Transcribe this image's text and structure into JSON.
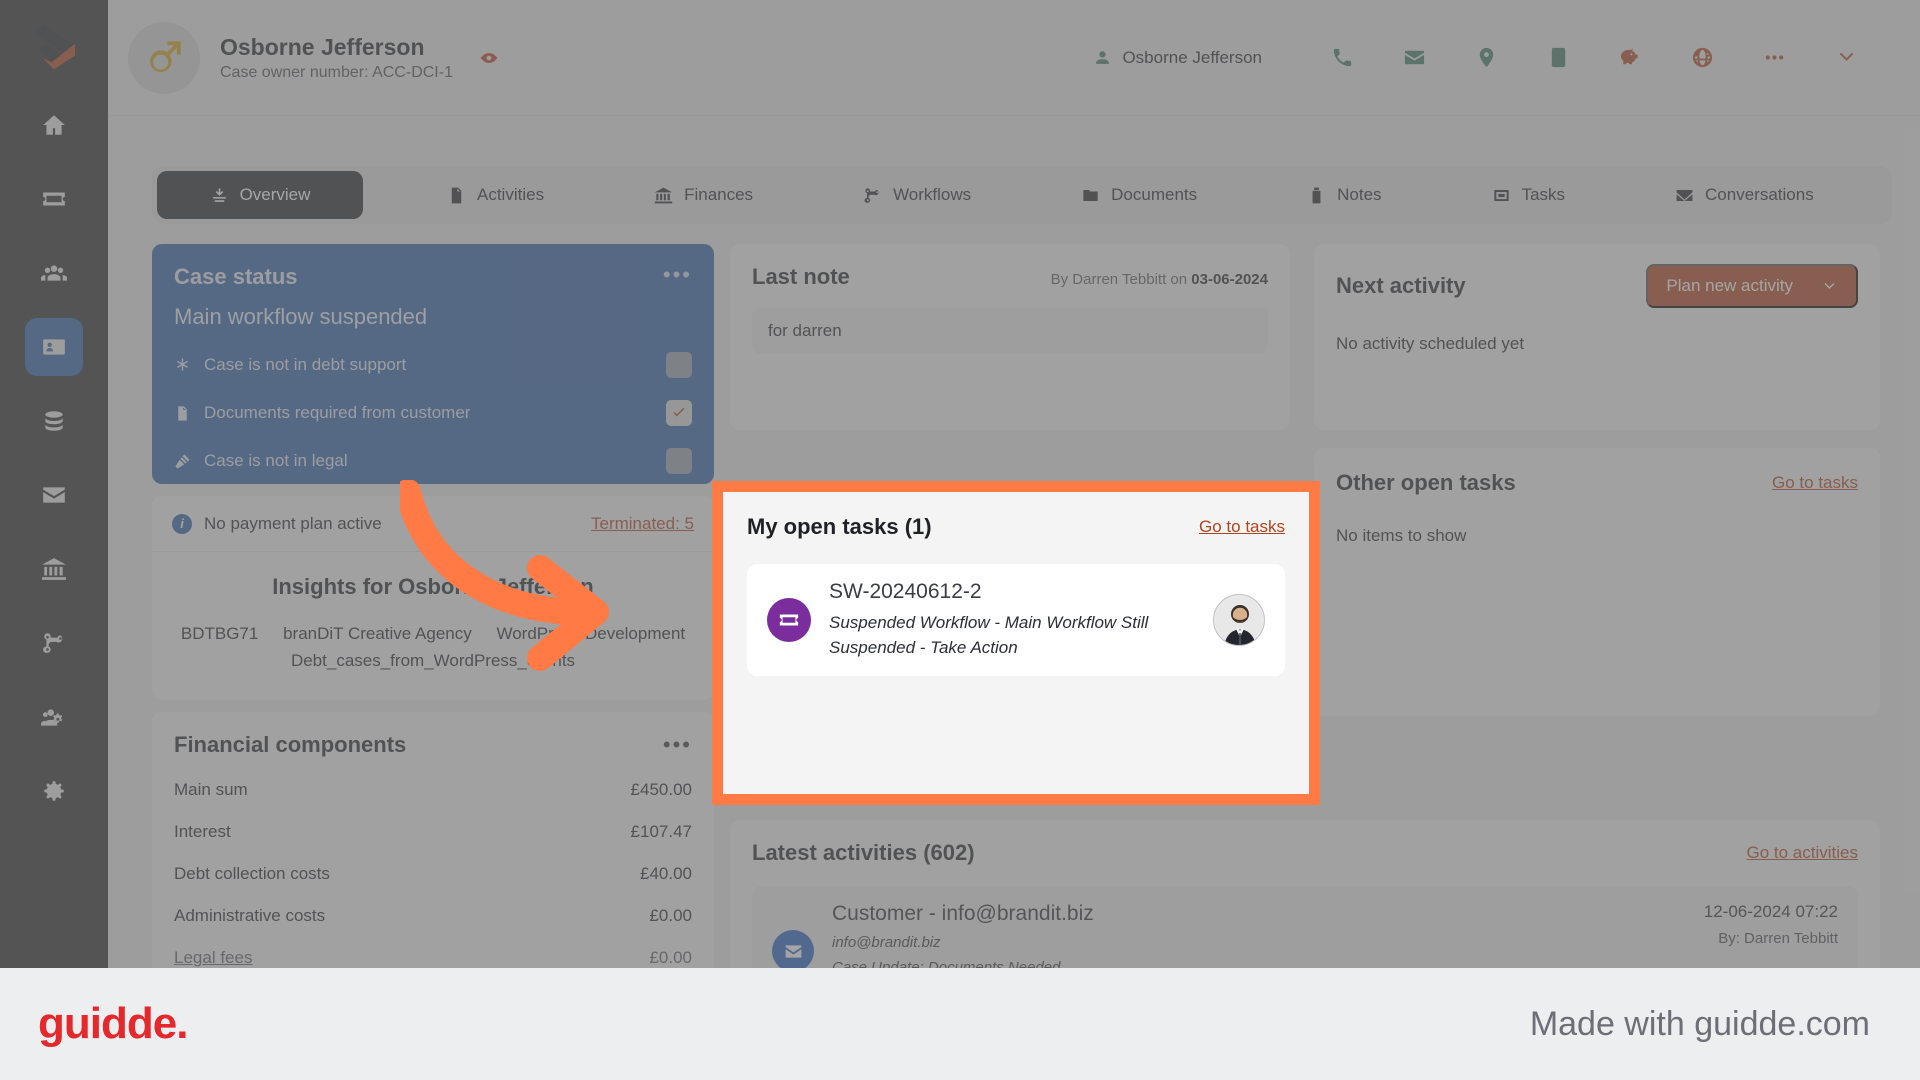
{
  "header": {
    "name": "Osborne Jefferson",
    "case_owner": "Case owner number: ACC-DCI-1",
    "owner_label": "Osborne Jefferson",
    "icons": [
      "phone-icon",
      "envelope-icon",
      "location-pin-icon",
      "mobile-icon",
      "piggy-bank-icon",
      "globe-icon",
      "ellipsis-icon",
      "chevron-down-icon"
    ]
  },
  "sidebar": {
    "items": [
      {
        "name": "home-icon"
      },
      {
        "name": "ticket-icon"
      },
      {
        "name": "people-icon"
      },
      {
        "name": "id-card-icon",
        "active": true
      },
      {
        "name": "database-icon"
      },
      {
        "name": "envelope-icon"
      },
      {
        "name": "bank-icon"
      },
      {
        "name": "workflow-icon"
      },
      {
        "name": "team-settings-icon"
      },
      {
        "name": "gear-icon"
      }
    ]
  },
  "tabs": [
    {
      "label": "Overview",
      "icon": "overview-icon",
      "active": true
    },
    {
      "label": "Activities",
      "icon": "activities-icon"
    },
    {
      "label": "Finances",
      "icon": "bank-icon"
    },
    {
      "label": "Workflows",
      "icon": "workflow-icon"
    },
    {
      "label": "Documents",
      "icon": "folder-icon"
    },
    {
      "label": "Notes",
      "icon": "note-icon"
    },
    {
      "label": "Tasks",
      "icon": "tasks-icon"
    },
    {
      "label": "Conversations",
      "icon": "conversations-icon"
    }
  ],
  "case_status": {
    "title": "Case status",
    "subtitle": "Main workflow suspended",
    "menu": "•••",
    "rows": [
      {
        "label": "Case is not in debt support",
        "icon": "asterisk-icon",
        "checked": false
      },
      {
        "label": "Documents required from customer",
        "icon": "document-icon",
        "checked": true
      },
      {
        "label": "Case is not in legal",
        "icon": "gavel-icon",
        "checked": false
      }
    ]
  },
  "payment_plan": {
    "label": "No payment plan active",
    "link": "Terminated: 5"
  },
  "insights": {
    "title": "Insights for Osborne Jefferson",
    "tags": [
      "BDTBG71",
      "branDiT Creative Agency",
      "WordPress Development",
      "Debt_cases_from_WordPress_clients"
    ]
  },
  "financial": {
    "title": "Financial components",
    "menu": "•••",
    "rows": [
      {
        "label": "Main sum",
        "value": "£450.00"
      },
      {
        "label": "Interest",
        "value": "£107.47"
      },
      {
        "label": "Debt collection costs",
        "value": "£40.00"
      },
      {
        "label": "Administrative costs",
        "value": "£0.00"
      },
      {
        "label": "Legal fees",
        "value": "£0.00"
      }
    ]
  },
  "last_note": {
    "title": "Last note",
    "meta_prefix": "By Darren Tebbitt on ",
    "meta_date": "03-06-2024",
    "body": "for darren"
  },
  "next_activity": {
    "title": "Next activity",
    "button": "Plan new activity",
    "empty": "No activity scheduled yet"
  },
  "my_open_tasks": {
    "title": "My open tasks (1)",
    "link": "Go to tasks",
    "task": {
      "id": "SW-20240612-2",
      "description": "Suspended Workflow - Main Workflow Still Suspended - Take Action",
      "icon": "ticket-icon"
    }
  },
  "other_open_tasks": {
    "title": "Other open tasks",
    "link": "Go to tasks",
    "empty": "No items to show"
  },
  "latest_activities": {
    "title": "Latest activities (602)",
    "link": "Go to activities",
    "items": [
      {
        "title": "Customer - info@brandit.biz",
        "email": "info@brandit.biz",
        "subject": "Case Update: Documents Needed",
        "date": "12-06-2024 07:22",
        "by": "By: Darren Tebbitt",
        "icon": "envelope-icon"
      }
    ]
  },
  "footer": {
    "logo": "guidde.",
    "made_with": "Made with guidde.com"
  },
  "colors": {
    "accent_orange": "#ff7a45",
    "brand_red": "#b0441f",
    "blue_card": "#2f5fa8",
    "purple": "#7b2d9e",
    "green": "#3f7d69",
    "guidde_red": "#e4282b"
  }
}
